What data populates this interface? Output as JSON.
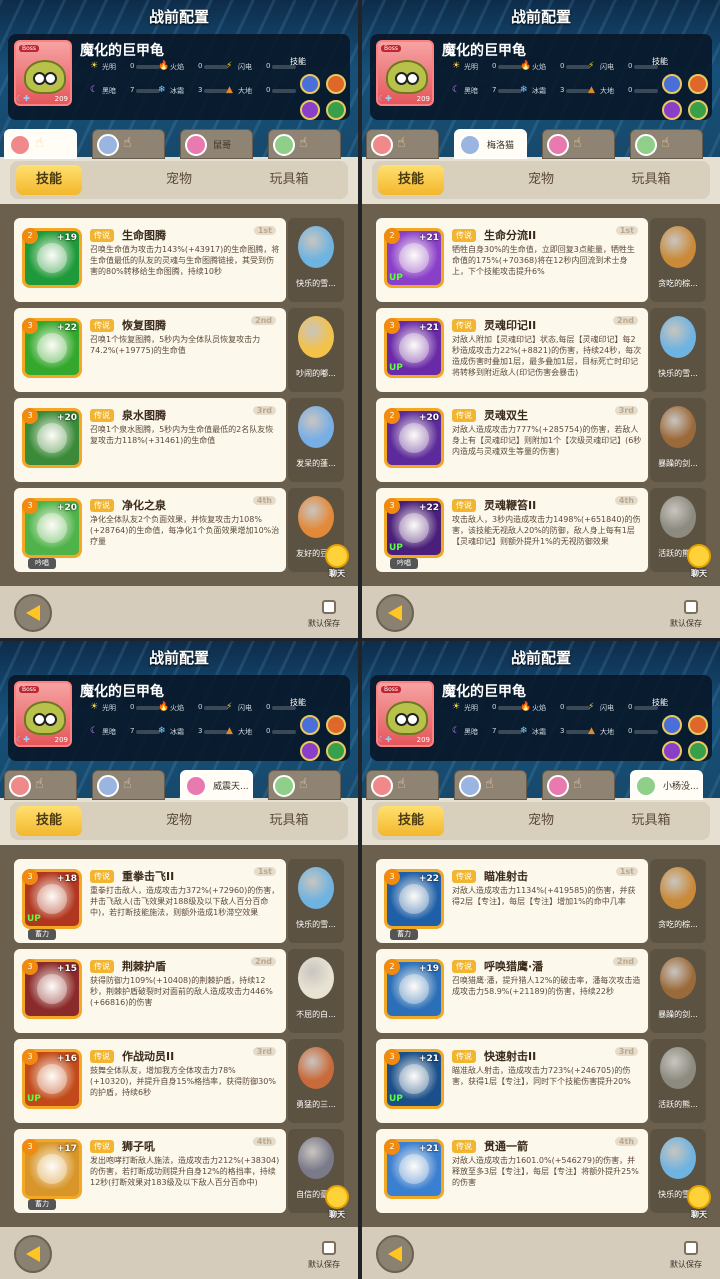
{
  "colors": {
    "accent": "#f3b72b",
    "blue": "#1565c0",
    "green": "#2e9e2e",
    "panel": "#e6e0d3"
  },
  "panels": [
    {
      "title": "战前配置",
      "boss": {
        "tag": "Boss",
        "name": "魔化的巨甲龟",
        "level": "209",
        "stats": [
          {
            "label": "光明",
            "value": "0"
          },
          {
            "label": "火焰",
            "value": "0"
          },
          {
            "label": "闪电",
            "value": "0"
          },
          {
            "label": "黑暗",
            "value": "7"
          },
          {
            "label": "冰霜",
            "value": "3"
          },
          {
            "label": "大地",
            "value": "0"
          }
        ],
        "skill_label": "技能"
      },
      "tabs": [
        {
          "name": ""
        },
        {
          "name": ""
        },
        {
          "name": "鼠哥"
        },
        {
          "name": ""
        }
      ],
      "selected_tab": 0,
      "segments": [
        "技能",
        "宠物",
        "玩具箱"
      ],
      "cards": [
        {
          "lv": "2",
          "plus": "+19",
          "up": "",
          "extra": "",
          "color": "#1f9a3a",
          "legend": "传说",
          "name": "生命图腾",
          "order": "1st",
          "desc": "召唤生命值为攻击力143%(+43917)的生命图腾，将生命值最低的队友的灵魂与生命图腾链接，其受到伤害的80%转移给生命图腾，持续10秒"
        },
        {
          "lv": "3",
          "plus": "+22",
          "up": "",
          "extra": "",
          "color": "#33a82c",
          "legend": "传说",
          "name": "恢复图腾",
          "order": "2nd",
          "desc": "召唤1个恢复图腾，5秒内为全体队员恢复攻击力74.2%(+19775)的生命值"
        },
        {
          "lv": "3",
          "plus": "+20",
          "up": "",
          "extra": "",
          "color": "#3b8a3a",
          "legend": "传说",
          "name": "泉水图腾",
          "order": "3rd",
          "desc": "召唤1个泉水图腾，5秒内为生命值最低的2名队友恢复攻击力118%(+31461)的生命值"
        },
        {
          "lv": "3",
          "plus": "+20",
          "up": "",
          "extra": "吟唱",
          "color": "#4fb34a",
          "legend": "传说",
          "name": "净化之泉",
          "order": "4th",
          "desc": "净化全体队友2个负面效果，并恢复攻击力108%(+28764)的生命值，每净化1个负面效果增加10%治疗量"
        }
      ],
      "pets": [
        {
          "name": "快乐的雪...",
          "color": "#6fb3e0"
        },
        {
          "name": "吵闹的嘟...",
          "color": "#f3c24a"
        },
        {
          "name": "发呆的蓬...",
          "color": "#78aee6"
        },
        {
          "name": "友好的豆...",
          "color": "#e3893a"
        }
      ],
      "chat": "聊天",
      "save": "默认保存"
    },
    {
      "title": "战前配置",
      "boss": {
        "tag": "Boss",
        "name": "魔化的巨甲龟",
        "level": "209",
        "stats": [
          {
            "label": "光明",
            "value": "0"
          },
          {
            "label": "火焰",
            "value": "0"
          },
          {
            "label": "闪电",
            "value": "0"
          },
          {
            "label": "黑暗",
            "value": "7"
          },
          {
            "label": "冰霜",
            "value": "3"
          },
          {
            "label": "大地",
            "value": "0"
          }
        ],
        "skill_label": "技能"
      },
      "tabs": [
        {
          "name": ""
        },
        {
          "name": "梅洛猫"
        },
        {
          "name": ""
        },
        {
          "name": ""
        }
      ],
      "selected_tab": 1,
      "segments": [
        "技能",
        "宠物",
        "玩具箱"
      ],
      "cards": [
        {
          "lv": "2",
          "plus": "+21",
          "up": "UP",
          "extra": "",
          "color": "#8a3fc9",
          "legend": "传说",
          "name": "生命分流II",
          "order": "1st",
          "desc": "牺牲自身30%的生命值，立即回复3点能量，牺牲生命值的175%(+70368)将在12秒内回流到术士身上，下个技能攻击提升6%"
        },
        {
          "lv": "3",
          "plus": "+21",
          "up": "UP",
          "extra": "",
          "color": "#6a2aa8",
          "legend": "传说",
          "name": "灵魂印记II",
          "order": "2nd",
          "desc": "对敌人附加【灵魂印记】状态,每层【灵魂印记】每2秒造成攻击力22%(+8821)的伤害，持续24秒，每次造成伤害时叠加1层，最多叠加1层，目标死亡时印记将转移到附近敌人(印记伤害会暴击)"
        },
        {
          "lv": "2",
          "plus": "+20",
          "up": "",
          "extra": "",
          "color": "#5c2a9a",
          "legend": "传说",
          "name": "灵魂双生",
          "order": "3rd",
          "desc": "对敌人造成攻击力777%(+285754)的伤害，若敌人身上有【灵魂印记】则附加1个【次级灵魂印记】(6秒内造成与灵魂双生等量的伤害)"
        },
        {
          "lv": "3",
          "plus": "+22",
          "up": "UP",
          "extra": "吟唱",
          "color": "#4a1f7a",
          "legend": "传说",
          "name": "灵魂鞭笞II",
          "order": "4th",
          "desc": "攻击敌人，3秒内造成攻击力1498%(+651840)的伤害，该技能无视敌人20%的防御，敌人身上每有1层【灵魂印记】则额外提升1%的无视防御效果"
        }
      ],
      "pets": [
        {
          "name": "贪吃的棕...",
          "color": "#c98a3a"
        },
        {
          "name": "快乐的雪...",
          "color": "#6fb3e0"
        },
        {
          "name": "暴躁的剑...",
          "color": "#9b6a3a"
        },
        {
          "name": "活跃的熊...",
          "color": "#8d8a80"
        }
      ],
      "chat": "聊天",
      "save": "默认保存"
    },
    {
      "title": "战前配置",
      "boss": {
        "tag": "Boss",
        "name": "魔化的巨甲龟",
        "level": "209",
        "stats": [
          {
            "label": "光明",
            "value": "0"
          },
          {
            "label": "火焰",
            "value": "0"
          },
          {
            "label": "闪电",
            "value": "0"
          },
          {
            "label": "黑暗",
            "value": "7"
          },
          {
            "label": "冰霜",
            "value": "3"
          },
          {
            "label": "大地",
            "value": "0"
          }
        ],
        "skill_label": "技能"
      },
      "tabs": [
        {
          "name": ""
        },
        {
          "name": ""
        },
        {
          "name": "威震天..."
        },
        {
          "name": ""
        }
      ],
      "selected_tab": 2,
      "segments": [
        "技能",
        "宠物",
        "玩具箱"
      ],
      "cards": [
        {
          "lv": "3",
          "plus": "+18",
          "up": "UP",
          "extra": "蓄力",
          "color": "#b0361f",
          "legend": "传说",
          "name": "重拳击飞II",
          "order": "1st",
          "desc": "重拳打击敌人，造成攻击力372%(+72960)的伤害，并击飞敌人(击飞效果对188级及以下敌人百分百命中)，若打断技能施法，则额外造成1秒滞空效果"
        },
        {
          "lv": "3",
          "plus": "+15",
          "up": "",
          "extra": "",
          "color": "#8a2a2a",
          "legend": "传说",
          "name": "荆棘护盾",
          "order": "2nd",
          "desc": "获得防御力109%(+10408)的荆棘护盾，持续12秒，荆棘护盾破裂时对面前的敌人造成攻击力446%(+66816)的伤害"
        },
        {
          "lv": "3",
          "plus": "+16",
          "up": "UP",
          "extra": "",
          "color": "#c24a1a",
          "legend": "传说",
          "name": "作战动员II",
          "order": "3rd",
          "desc": "鼓舞全体队友，增加我方全体攻击力78%(+10320)，并提升自身15%格挡率，获得防御30%的护盾，持续6秒"
        },
        {
          "lv": "3",
          "plus": "+17",
          "up": "",
          "extra": "蓄力",
          "color": "#d8962a",
          "legend": "传说",
          "name": "狮子吼",
          "order": "4th",
          "desc": "发出咆哮打断敌人施法，造成攻击力212%(+38304)的伤害，若打断成功则提升自身12%的格挡率，持续12秒(打断效果对183级及以下敌人百分百命中)"
        }
      ],
      "pets": [
        {
          "name": "快乐的雪...",
          "color": "#6fb3e0"
        },
        {
          "name": "不屈的白...",
          "color": "#e8e2d2"
        },
        {
          "name": "勇猛的三...",
          "color": "#c96a3a"
        },
        {
          "name": "自信的豪...",
          "color": "#7a7a8a"
        }
      ],
      "chat": "聊天",
      "save": "默认保存"
    },
    {
      "title": "战前配置",
      "boss": {
        "tag": "Boss",
        "name": "魔化的巨甲龟",
        "level": "209",
        "stats": [
          {
            "label": "光明",
            "value": "0"
          },
          {
            "label": "火焰",
            "value": "0"
          },
          {
            "label": "闪电",
            "value": "0"
          },
          {
            "label": "黑暗",
            "value": "7"
          },
          {
            "label": "冰霜",
            "value": "3"
          },
          {
            "label": "大地",
            "value": "0"
          }
        ],
        "skill_label": "技能"
      },
      "tabs": [
        {
          "name": ""
        },
        {
          "name": ""
        },
        {
          "name": ""
        },
        {
          "name": "小杨没..."
        }
      ],
      "selected_tab": 3,
      "segments": [
        "技能",
        "宠物",
        "玩具箱"
      ],
      "cards": [
        {
          "lv": "3",
          "plus": "+22",
          "up": "",
          "extra": "蓄力",
          "color": "#1e5fa8",
          "legend": "传说",
          "name": "瞄准射击",
          "order": "1st",
          "desc": "对敌人造成攻击力1134%(+419585)的伤害，并获得2层【专注】，每层【专注】增加1%的命中几率"
        },
        {
          "lv": "2",
          "plus": "+19",
          "up": "",
          "extra": "",
          "color": "#2a6fb8",
          "legend": "传说",
          "name": "呼唤猎鹰·潘",
          "order": "2nd",
          "desc": "召唤猎鹰·潘，提升猎人12%的破击率，潘每次攻击造成攻击力58.9%(+21189)的伤害，持续22秒"
        },
        {
          "lv": "3",
          "plus": "+21",
          "up": "UP",
          "extra": "",
          "color": "#1a4f8a",
          "legend": "传说",
          "name": "快速射击II",
          "order": "3rd",
          "desc": "瞄准敌人射击，造成攻击力723%(+246705)的伤害，获得1层【专注】，同时下个技能伤害提升20%"
        },
        {
          "lv": "2",
          "plus": "+21",
          "up": "",
          "extra": "",
          "color": "#3a7fd0",
          "legend": "传说",
          "name": "贯通一箭",
          "order": "4th",
          "desc": "对敌人造成攻击力1601.0%(+546279)的伤害，并释放至多3层【专注】，每层【专注】将额外提升25%的伤害"
        }
      ],
      "pets": [
        {
          "name": "贪吃的棕...",
          "color": "#c98a3a"
        },
        {
          "name": "暴躁的剑...",
          "color": "#9b6a3a"
        },
        {
          "name": "活跃的熊...",
          "color": "#8d8a80"
        },
        {
          "name": "快乐的雪...",
          "color": "#6fb3e0"
        }
      ],
      "chat": "聊天",
      "save": "默认保存"
    }
  ]
}
